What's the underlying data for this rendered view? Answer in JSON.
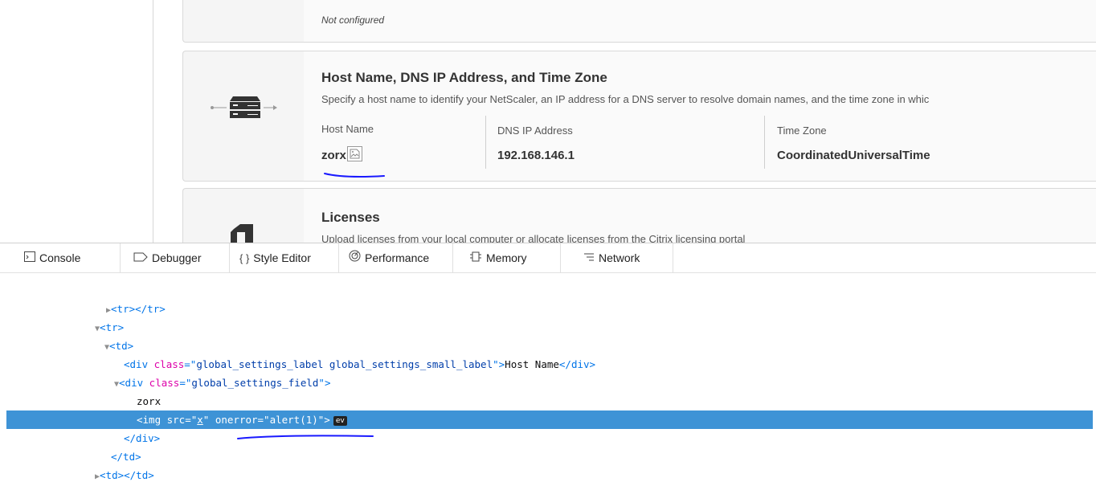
{
  "card_prev": {
    "status": "Not configured"
  },
  "card_host": {
    "title": "Host Name, DNS IP Address, and Time Zone",
    "description": "Specify a host name to identify your NetScaler, an IP address for a DNS server to resolve domain names, and the time zone in whic",
    "fields": [
      {
        "label": "Host Name",
        "value": "zorx"
      },
      {
        "label": "DNS IP Address",
        "value": "192.168.146.1"
      },
      {
        "label": "Time Zone",
        "value": "CoordinatedUniversalTime"
      }
    ]
  },
  "card_licenses": {
    "title": "Licenses",
    "description": "Upload licenses from your local computer or allocate licenses from the Citrix licensing portal"
  },
  "devtools": {
    "tabs": [
      {
        "label": "Console",
        "icon": "console-icon"
      },
      {
        "label": "Debugger",
        "icon": "debugger-icon"
      },
      {
        "label": "Style Editor",
        "icon": "style-editor-icon"
      },
      {
        "label": "Performance",
        "icon": "performance-icon"
      },
      {
        "label": "Memory",
        "icon": "memory-icon"
      },
      {
        "label": "Network",
        "icon": "network-icon"
      }
    ],
    "markup": {
      "tr_collapsed": "<tr></tr>",
      "tr_open": "<tr>",
      "td_open": "<td>",
      "label_div_tag_open": "<div ",
      "label_div_attr": "class",
      "label_div_eq": "=\"",
      "label_div_class": "global_settings_label global_settings_small_label",
      "label_div_close_q": "\">",
      "label_div_text": "Host Name",
      "label_div_end": "</div>",
      "field_div_tag_open": "<div ",
      "field_div_attr": "class",
      "field_div_class": "global_settings_field",
      "text_node": "zorx",
      "img_line_pre": "<img src=\"",
      "img_src": "x",
      "img_line_mid": "\" onerror=\"alert(1)\">",
      "event_badge": "ev",
      "div_close": "</div>",
      "td_close": "</td>",
      "td_collapsed": "<td></td>"
    }
  },
  "colors": {
    "selection": "#3e93d6",
    "annotation": "#1a1aff"
  }
}
